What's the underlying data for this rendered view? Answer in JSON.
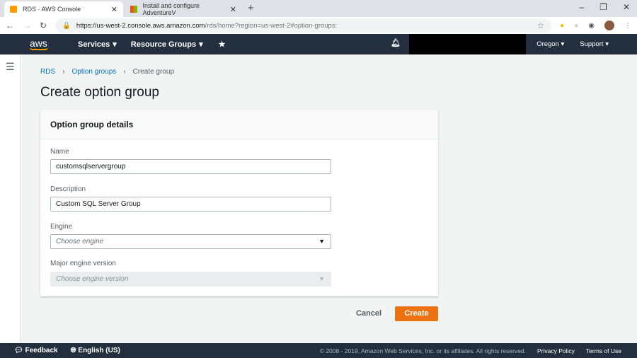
{
  "browser": {
    "tabs": [
      {
        "title": "RDS · AWS Console"
      },
      {
        "title": "Install and configure AdventureV"
      }
    ],
    "url_host": "https://us-west-2.console.aws.amazon.com",
    "url_path": "/rds/home?region=us-west-2#option-groups:"
  },
  "nav": {
    "logo": "aws",
    "services": "Services",
    "resource_groups": "Resource Groups",
    "region": "Oregon",
    "support": "Support"
  },
  "breadcrumb": [
    "RDS",
    "Option groups",
    "Create group"
  ],
  "page_title": "Create option group",
  "panel": {
    "title": "Option group details",
    "name_label": "Name",
    "name_value": "customsqlservergroup",
    "desc_label": "Description",
    "desc_value": "Custom SQL Server Group",
    "engine_label": "Engine",
    "engine_placeholder": "Choose engine",
    "version_label": "Major engine version",
    "version_placeholder": "Choose engine version"
  },
  "actions": {
    "cancel": "Cancel",
    "create": "Create"
  },
  "footer": {
    "feedback": "Feedback",
    "language": "English (US)",
    "copyright": "© 2008 - 2019, Amazon Web Services, Inc. or its affiliates. All rights reserved.",
    "privacy": "Privacy Policy",
    "terms": "Terms of Use"
  }
}
